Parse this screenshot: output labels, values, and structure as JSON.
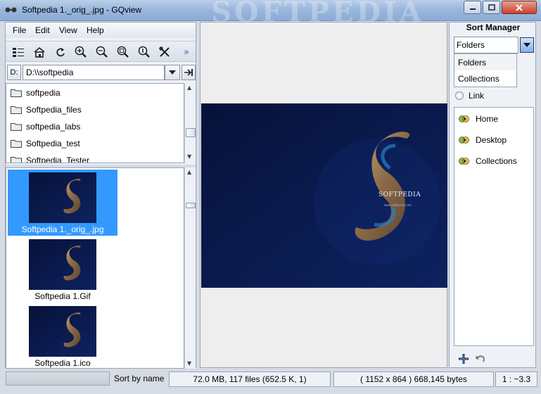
{
  "window": {
    "title": "Softpedia 1._orig_.jpg - GQview",
    "watermark": "SOFTPEDIA"
  },
  "menu": [
    "File",
    "Edit",
    "View",
    "Help"
  ],
  "toolbar": {
    "icons": [
      "thumbnails-icon",
      "home-icon",
      "refresh-icon",
      "zoom-in-icon",
      "zoom-out-icon",
      "zoom-fit-icon",
      "zoom-1to1-icon",
      "config-icon"
    ],
    "overflow": "»"
  },
  "path": {
    "drive_label": "D:",
    "value": "D:\\\\softpedia"
  },
  "folders": [
    {
      "label": "softpedia"
    },
    {
      "label": "Softpedia_files"
    },
    {
      "label": "softpedia_labs"
    },
    {
      "label": "Softpedia_test"
    },
    {
      "label": "Softpedia_Tester"
    }
  ],
  "thumbnails": [
    {
      "label": "Softpedia 1._orig_.jpg",
      "selected": true
    },
    {
      "label": "Softpedia 1.Gif",
      "selected": false
    },
    {
      "label": "Softpedia 1.ico",
      "selected": false
    }
  ],
  "sort_manager": {
    "title": "Sort Manager",
    "selected": "Folders",
    "options": [
      "Folders",
      "Collections"
    ],
    "link_label": "Link",
    "bookmarks": [
      {
        "label": "Home",
        "icon": "home-bookmark-icon"
      },
      {
        "label": "Desktop",
        "icon": "desktop-bookmark-icon"
      },
      {
        "label": "Collections",
        "icon": "collections-bookmark-icon"
      }
    ]
  },
  "status": {
    "sort": "Sort by name",
    "files": "72.0 MB, 117 files (652.5 K, 1)",
    "image_info": "( 1152 x 864 ) 668,145 bytes",
    "zoom": "1 : ~3.3"
  },
  "image_text": {
    "brand": "SOFTPEDIA",
    "url": "www.softpedia.com"
  },
  "colors": {
    "selection": "#3399ff",
    "image_background": "#0b1a4a"
  }
}
